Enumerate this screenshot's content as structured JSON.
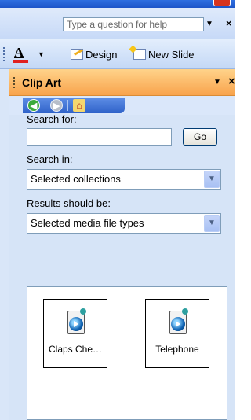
{
  "help": {
    "placeholder": "Type a question for help",
    "close": "×"
  },
  "toolbar": {
    "font_color_letter": "A",
    "design_label": "Design",
    "new_slide_label": "New Slide"
  },
  "pane": {
    "title": "Clip Art",
    "menu_arrow": "▼",
    "close": "×"
  },
  "nav": {
    "back": "◀",
    "forward": "▶",
    "home": "⌂"
  },
  "search": {
    "label": "Search for:",
    "value": "",
    "go_label": "Go"
  },
  "search_in": {
    "label": "Search in:",
    "selected": "Selected collections"
  },
  "results_type": {
    "label": "Results should be:",
    "selected": "Selected media file types"
  },
  "results": [
    {
      "caption": "Claps Che…"
    },
    {
      "caption": "Telephone"
    }
  ],
  "colors": {
    "header": "#f8a34c",
    "pane_bg": "#d6e4f7",
    "accent": "#2f62c9"
  }
}
